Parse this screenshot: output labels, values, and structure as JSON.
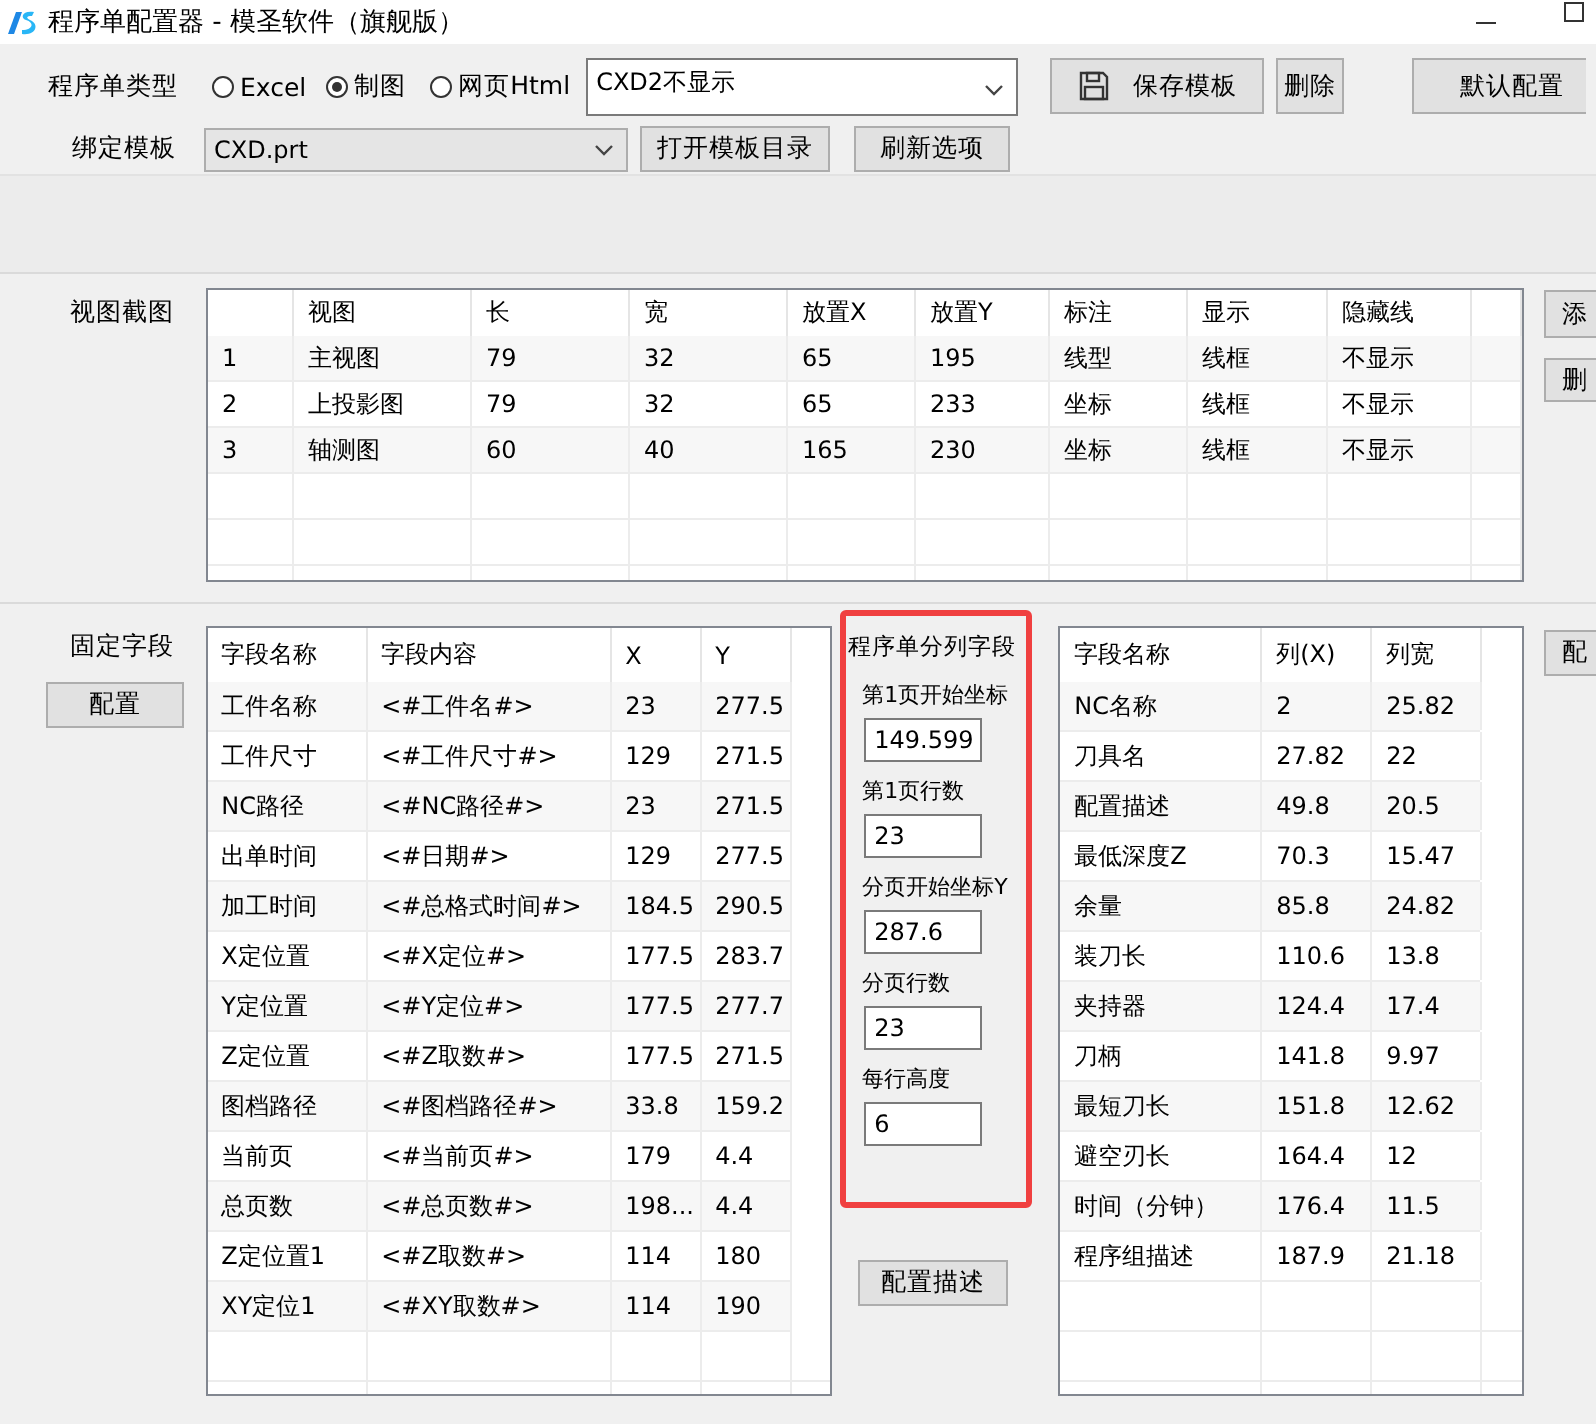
{
  "window": {
    "title": "程序单配置器 - 模圣软件（旗舰版）"
  },
  "type_row": {
    "label": "程序单类型",
    "options": [
      {
        "label": "Excel",
        "selected": false
      },
      {
        "label": "制图",
        "selected": true
      },
      {
        "label": "网页Html",
        "selected": false
      }
    ],
    "template_select": {
      "value": "CXD2不显示"
    },
    "buttons": [
      {
        "label": "保存模板",
        "kind": "save"
      },
      {
        "label": "删除",
        "kind": "small"
      },
      {
        "label": "默认配置",
        "kind": "edge"
      }
    ]
  },
  "bind_row": {
    "label": "绑定模板",
    "select": {
      "value": "CXD.prt"
    },
    "buttons": [
      "打开模板目录",
      "刷新选项"
    ]
  },
  "views": {
    "label": "视图截图",
    "columns": [
      "视图",
      "长",
      "宽",
      "放置X",
      "放置Y",
      "标注",
      "显示",
      "隐藏线"
    ],
    "rows": [
      {
        "number": "1",
        "cells": [
          "主视图",
          "79",
          "32",
          "65",
          "195",
          "线型",
          "线框",
          "不显示"
        ]
      },
      {
        "number": "2",
        "cells": [
          "上投影图",
          "79",
          "32",
          "65",
          "233",
          "坐标",
          "线框",
          "不显示"
        ]
      },
      {
        "number": "3",
        "cells": [
          "轴测图",
          "60",
          "40",
          "165",
          "230",
          "坐标",
          "线框",
          "不显示"
        ]
      }
    ],
    "side_buttons": [
      "添",
      "删"
    ]
  },
  "fixed": {
    "label": "固定字段",
    "button": "配置",
    "columns": [
      "字段名称",
      "字段内容",
      "X",
      "Y"
    ],
    "rows": [
      [
        "工件名称",
        "<#工件名#>",
        "23",
        "277.5"
      ],
      [
        "工件尺寸",
        "<#工件尺寸#>",
        "129",
        "271.5"
      ],
      [
        "NC路径",
        "<#NC路径#>",
        "23",
        "271.5"
      ],
      [
        "出单时间",
        "<#日期#>",
        "129",
        "277.5"
      ],
      [
        "加工时间",
        "<#总格式时间#>",
        "184.5",
        "290.5"
      ],
      [
        "X定位置",
        "<#X定位#>",
        "177.5",
        "283.7"
      ],
      [
        "Y定位置",
        "<#Y定位#>",
        "177.5",
        "277.7"
      ],
      [
        "Z定位置",
        "<#Z取数#>",
        "177.5",
        "271.5"
      ],
      [
        "图档路径",
        "<#图档路径#>",
        "33.8",
        "159.2"
      ],
      [
        "当前页",
        "<#当前页#>",
        "179",
        "4.4"
      ],
      [
        "总页数",
        "<#总页数#>",
        "198...",
        "4.4"
      ],
      [
        "Z定位置1",
        "<#Z取数#>",
        "114",
        "180"
      ],
      [
        "XY定位1",
        "<#XY取数#>",
        "114",
        "190"
      ]
    ]
  },
  "paging": {
    "title": "程序单分列字段",
    "highlighted": true,
    "fields": [
      {
        "label": "第1页开始坐标",
        "value": "149.599"
      },
      {
        "label": "第1页行数",
        "value": "23"
      },
      {
        "label": "分页开始坐标Y",
        "value": "287.6"
      },
      {
        "label": "分页行数",
        "value": "23"
      },
      {
        "label": "每行高度",
        "value": "6"
      }
    ],
    "button": "配置描述"
  },
  "column_fields": {
    "columns": [
      "字段名称",
      "列(X)",
      "列宽"
    ],
    "rows": [
      [
        "NC名称",
        "2",
        "25.82"
      ],
      [
        "刀具名",
        "27.82",
        "22"
      ],
      [
        "配置描述",
        "49.8",
        "20.5"
      ],
      [
        "最低深度Z",
        "70.3",
        "15.47"
      ],
      [
        "余量",
        "85.8",
        "24.82"
      ],
      [
        "装刀长",
        "110.6",
        "13.8"
      ],
      [
        "夹持器",
        "124.4",
        "17.4"
      ],
      [
        "刀柄",
        "141.8",
        "9.97"
      ],
      [
        "最短刀长",
        "151.8",
        "12.62"
      ],
      [
        "避空刃长",
        "164.4",
        "12"
      ],
      [
        "时间（分钟）",
        "176.4",
        "11.5"
      ],
      [
        "程序组描述",
        "187.9",
        "21.18"
      ]
    ],
    "side_button": "配"
  }
}
